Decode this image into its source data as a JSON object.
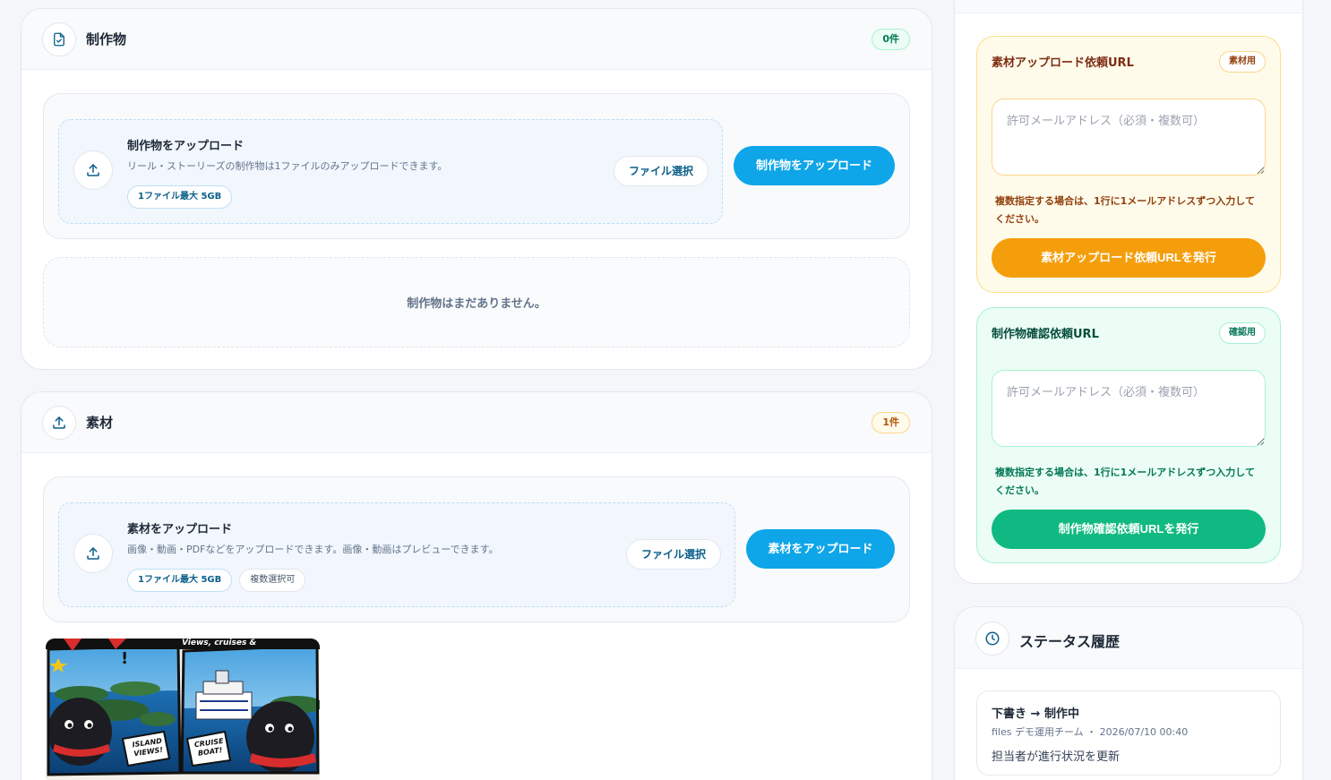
{
  "deliverables": {
    "title": "制作物",
    "count_badge": "0件",
    "upload": {
      "title": "制作物をアップロード",
      "description": "リール・ストーリーズの制作物は1ファイルのみアップロードできます。",
      "chips": [
        "1ファイル最大 5GB"
      ],
      "file_button": "ファイル選択",
      "upload_button": "制作物をアップロード"
    },
    "empty_message": "制作物はまだありません。"
  },
  "materials": {
    "title": "素材",
    "count_badge": "1件",
    "upload": {
      "title": "素材をアップロード",
      "description": "画像・動画・PDFなどをアップロードできます。画像・動画はプレビューできます。",
      "chips": [
        "1ファイル最大 5GB",
        "複数選択可"
      ],
      "file_button": "ファイル選択",
      "upload_button": "素材をアップロード"
    },
    "thumbnail": {
      "banner": "Views, cruises &",
      "bubble_left": "ISLAND VIEWS!",
      "bubble_right": "CRUISE BOAT!"
    }
  },
  "url_requests": {
    "material": {
      "title": "素材アップロード依頼URL",
      "badge": "素材用",
      "placeholder": "許可メールアドレス（必須・複数可）",
      "hint": "複数指定する場合は、1行に1メールアドレスずつ入力してください。",
      "button": "素材アップロード依頼URLを発行",
      "accent": "#f59e0b"
    },
    "review": {
      "title": "制作物確認依頼URL",
      "badge": "確認用",
      "placeholder": "許可メールアドレス（必須・複数可）",
      "hint": "複数指定する場合は、1行に1メールアドレスずつ入力してください。",
      "button": "制作物確認依頼URLを発行",
      "accent": "#10b981"
    }
  },
  "status_history": {
    "title": "ステータス履歴",
    "items": [
      {
        "title": "下書き → 制作中",
        "meta": "files デモ運用チーム ・ 2026/07/10 00:40",
        "note": "担当者が進行状況を更新"
      }
    ]
  },
  "icons": {
    "deliverables": "file-check-icon",
    "materials": "upload-icon",
    "history": "clock-icon"
  },
  "colors": {
    "primary": "#0ea5e9",
    "orange": "#f59e0b",
    "green": "#10b981"
  }
}
